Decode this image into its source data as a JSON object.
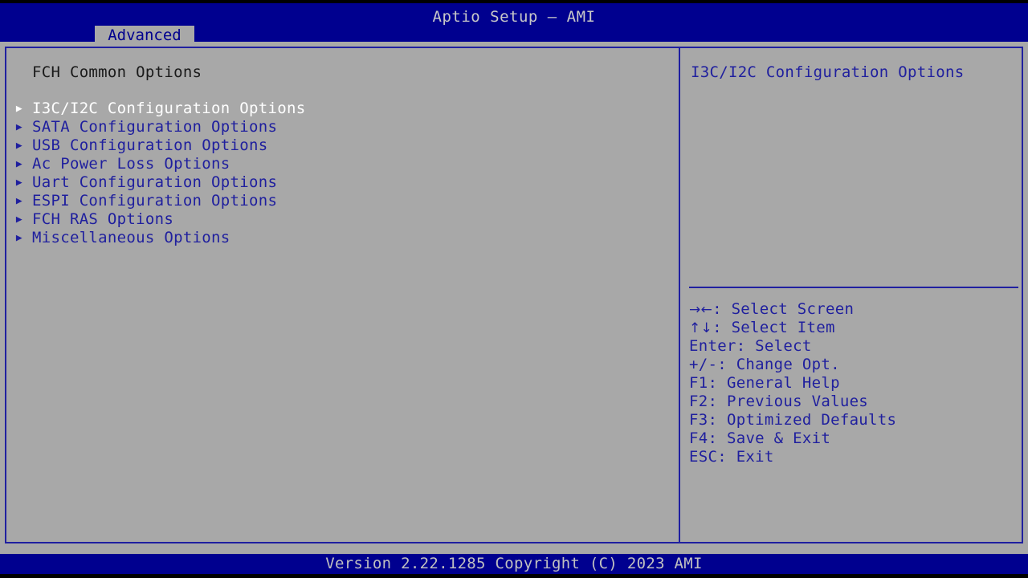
{
  "header": {
    "title": "Aptio Setup – AMI",
    "tabs": [
      {
        "label": "Advanced",
        "active": true
      }
    ]
  },
  "left_pane": {
    "section_heading": "FCH Common Options",
    "menu_items": [
      {
        "label": "I3C/I2C Configuration Options",
        "arrow": "triangle-right-icon",
        "selected": true
      },
      {
        "label": "SATA Configuration Options",
        "arrow": "triangle-right-icon",
        "selected": false
      },
      {
        "label": "USB Configuration Options",
        "arrow": "triangle-right-icon",
        "selected": false
      },
      {
        "label": "Ac Power Loss Options",
        "arrow": "triangle-right-icon",
        "selected": false
      },
      {
        "label": "Uart Configuration Options",
        "arrow": "triangle-right-icon",
        "selected": false
      },
      {
        "label": "ESPI Configuration Options",
        "arrow": "triangle-right-icon",
        "selected": false
      },
      {
        "label": "FCH RAS Options",
        "arrow": "triangle-right-icon",
        "selected": false
      },
      {
        "label": "Miscellaneous Options",
        "arrow": "triangle-right-icon",
        "selected": false
      }
    ]
  },
  "right_pane": {
    "help_text": "I3C/I2C Configuration Options",
    "legend": [
      {
        "keys": "→←",
        "text": ": Select Screen",
        "glyph_keys": true
      },
      {
        "keys": "↑↓",
        "text": ": Select Item",
        "glyph_keys": true
      },
      {
        "keys": "Enter",
        "text": ": Select",
        "glyph_keys": false
      },
      {
        "keys": "+/-",
        "text": ": Change Opt.",
        "glyph_keys": false
      },
      {
        "keys": "F1",
        "text": ": General Help",
        "glyph_keys": false
      },
      {
        "keys": "F2",
        "text": ": Previous Values",
        "glyph_keys": false
      },
      {
        "keys": "F3",
        "text": ": Optimized Defaults",
        "glyph_keys": false
      },
      {
        "keys": "F4",
        "text": ": Save & Exit",
        "glyph_keys": false
      },
      {
        "keys": "ESC",
        "text": ": Exit",
        "glyph_keys": false
      }
    ]
  },
  "footer": {
    "version_text": "Version 2.22.1285 Copyright (C) 2023 AMI"
  },
  "colors": {
    "header_blue": "#00008f",
    "panel_gray": "#a8a8a8",
    "border_blue": "#2020a0",
    "text_blue": "#1f1f9e",
    "text_selected": "#ffffff",
    "heading_black": "#1a1a1a",
    "footer_text": "#c0c0c0"
  }
}
